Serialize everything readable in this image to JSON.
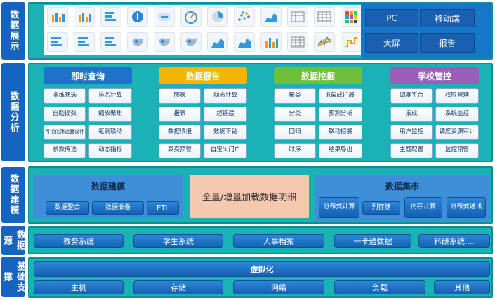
{
  "side_labels": [
    "数据展示",
    "数据分析",
    "数据建模",
    "数据源",
    "基础支撑"
  ],
  "display": {
    "icons_row1": [
      "bar-chart-icon",
      "bar-chart-icon",
      "hbar-chart-icon",
      "number-card-icon",
      "text-card-icon",
      "gauge-icon",
      "pie-chart-icon",
      "scatter-icon",
      "area-chart-icon",
      "table-icon",
      "grid-table-icon",
      "heatmap-icon"
    ],
    "icons_row2": [
      "hbar-chart-icon",
      "hbar-chart-icon",
      "hbar-chart-icon",
      "map-icon",
      "map-icon",
      "map-icon",
      "area-chart-icon",
      "area-chart-icon",
      "bar-chart-icon",
      "grid-table-icon",
      "line-chart-icon",
      "step-chart-icon"
    ],
    "targets": [
      "PC",
      "移动端",
      "大屏",
      "报告"
    ]
  },
  "analysis": {
    "columns": [
      {
        "title": "即时查询",
        "color": "#1e73c8",
        "items": [
          "多维筛选",
          "排名计算",
          "自助提数",
          "缩放聚焦",
          "可视化筛选器设计",
          "笔刷联动",
          "参数传递",
          "动态指标"
        ]
      },
      {
        "title": "数据报告",
        "color": "#f2b600",
        "items": [
          "图表",
          "动态计算",
          "报表",
          "超链接",
          "数据填报",
          "数据下钻",
          "高亮预警",
          "自定义门户"
        ]
      },
      {
        "title": "数据挖掘",
        "color": "#6fbf3a",
        "items": [
          "聚类",
          "R集成扩展",
          "分类",
          "预测分析",
          "回归",
          "联动挖掘",
          "时序",
          "结果导出"
        ]
      },
      {
        "title": "学校管控",
        "color": "#9b5fb8",
        "items": [
          "调度平台",
          "权限管理",
          "集成",
          "系统监控",
          "用户监控",
          "调度资源审计",
          "主题配置",
          "监控预警"
        ]
      }
    ]
  },
  "modeling": {
    "left_title": "数据建模",
    "left_items": [
      "数据整合",
      "数据准备",
      "ETL"
    ],
    "center_text": "全量/增量加载数据明细",
    "right_title": "数据集市",
    "right_items": [
      "分布式计算",
      "列存储",
      "内存计算",
      "分布式通讯"
    ]
  },
  "sources": [
    "教务系统",
    "学生系统",
    "人事档案",
    "一卡通数据",
    "科研系统...."
  ],
  "infra": {
    "virtual": "虚拟化",
    "items": [
      "主机",
      "存储",
      "网络",
      "负载",
      "其他"
    ]
  }
}
